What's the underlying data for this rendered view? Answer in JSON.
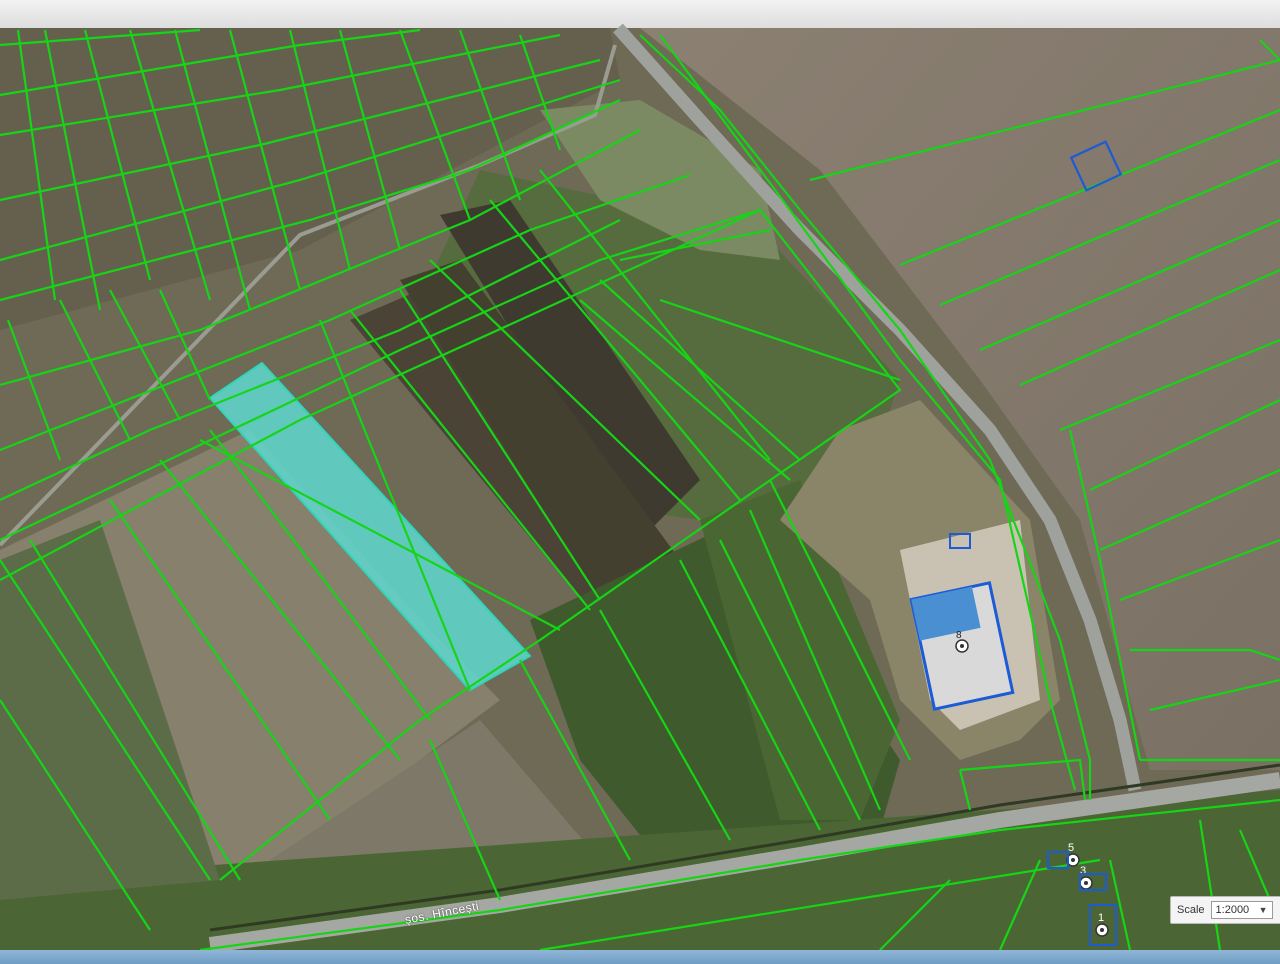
{
  "map": {
    "road_label": "șos. Hîncești",
    "parcel_numbers": [
      "8",
      "5",
      "3",
      "1"
    ],
    "selected_parcel_color": "#5fd8d0",
    "parcel_outline_color": "#18d418",
    "building_outline_color": "#1b5bd6"
  },
  "scale_control": {
    "label": "Scale",
    "value": "1:2000"
  },
  "icons": [
    "chevron-down-icon",
    "marker-icon"
  ]
}
